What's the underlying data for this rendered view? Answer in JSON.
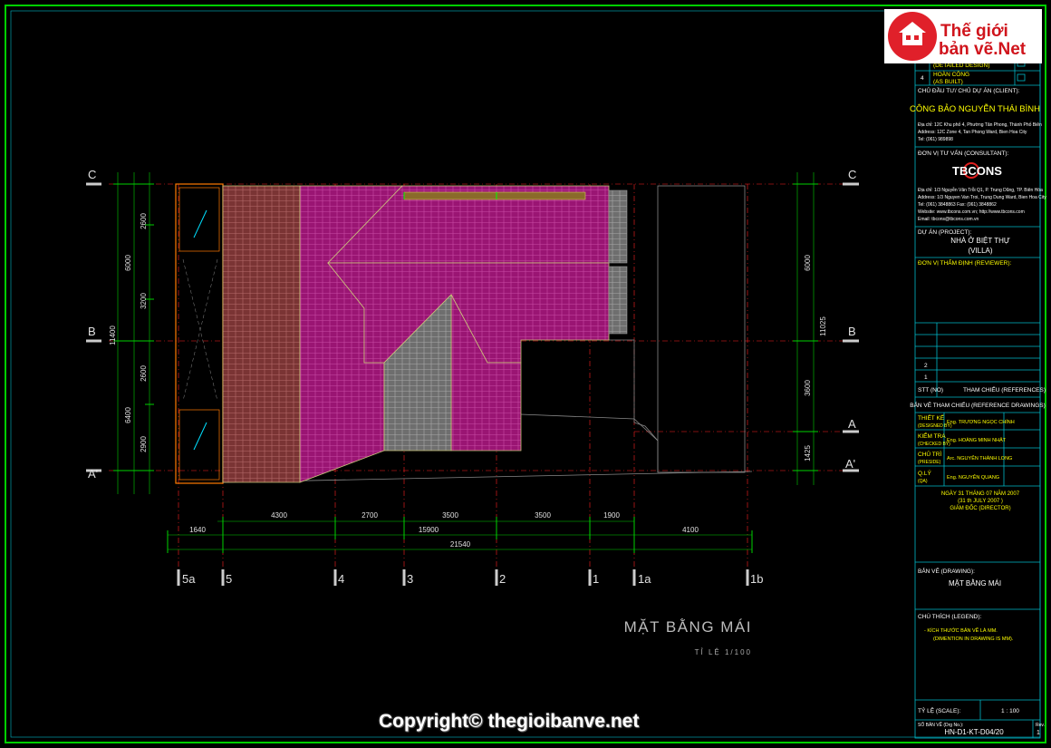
{
  "drawing": {
    "grid_rows": [
      "C",
      "B",
      "A",
      "A'"
    ],
    "grid_cols": [
      "5a",
      "5",
      "4",
      "3",
      "2",
      "1",
      "1a",
      "1b"
    ],
    "dims_top": [
      "4300",
      "2700",
      "3500",
      "3500",
      "1900"
    ],
    "dims_mid": [
      "1640",
      "15900",
      "4100"
    ],
    "dims_total": "21540",
    "dims_left_inner": [
      "2600",
      "3200",
      "2600",
      "2900"
    ],
    "dims_left_outer": [
      "6000",
      "6400"
    ],
    "dim_left_total": "11400",
    "dims_right": [
      "6000",
      "3600",
      "1425"
    ],
    "dim_right_total": "11025",
    "title": "MẶT BẰNG MÁI",
    "scale": "TỈ LỆ 1/100"
  },
  "title_block": {
    "rev_top_label": "(DETAILED DESIGN)",
    "rev_4_no": "4",
    "rev_4_label": "HOÀN CÔNG",
    "rev_4_sub": "(AS BUILT)",
    "client_label": "CHỦ ĐẦU TƯ/ CHỦ DỰ ÁN (CLIENT):",
    "client_name": "CÔNG BẢO NGUYỄN THÁI BÌNH",
    "client_addr1": "Địa chỉ: 12C Khu phố 4, Phường Tân Phong, Thành Phố Biên",
    "client_addr2": "Address: 12C Zone 4, Tan Phong Ward, Bien Hoa City",
    "client_tel": "Tel: (061) 989898",
    "consultant_label": "ĐƠN VỊ TƯ VẤN (CONSULTANT):",
    "consultant_logo": "TBCONS",
    "consultant_addr1": "Địa chỉ: 1/3 Nguyễn Văn Trỗi Q1, P. Trung Dũng, TP. Biên Hòa",
    "consultant_addr2": "Address: 1/3 Nguyen Van Troi, Trung Dung Ward, Bien Hoa City",
    "consultant_tel": "Tel: (061) 3848863          Fax: (061) 3848862",
    "consultant_web": "Website: www.tbcons.com.vn; http://www.tbcons.com",
    "consultant_email": "Email: tbcons@tbcons.com.vn",
    "project_label": "DỰ ÁN (PROJECT):",
    "project_name": "NHÀ Ở BIỆT THỰ",
    "project_sub": "(VILLA)",
    "reviewer_label": "ĐƠN VỊ THẨM ĐỊNH (REVIEWER):",
    "ref_no_2": "2",
    "ref_no_1": "1",
    "ref_stt": "STT (NO)",
    "ref_label": "THAM CHIẾU (REFERENCES)",
    "ref_drawings": "BẢN VẼ THAM CHIẾU (REFERENCE DRAWINGS)",
    "role_design": "THIẾT KẾ",
    "role_design_sub": "(DESIGNED BY)",
    "role_design_name": "Eng. TRƯƠNG NGỌC CHÍNH",
    "role_check": "KIỂM TRA",
    "role_check_sub": "(CHECKED BY)",
    "role_check_name": "Eng. HOÀNG MINH NHẬT",
    "role_chair": "CHỦ TRÌ",
    "role_chair_sub": "(PRESIDE)",
    "role_chair_name": "Arc. NGUYỄN THÀNH LONG",
    "role_mgr": "Q.LÝ",
    "role_mgr_sub": "(QA)",
    "role_mgr_name": "Eng. NGUYỄN QUANG",
    "date_line1": "NGÀY 31 THÁNG 07 NĂM 2007",
    "date_line2": "(31 th JULY 2007 )",
    "date_line3": "GIÁM ĐỐC (DIRECTOR)",
    "drawing_label": "BẢN VẼ (DRAWING):",
    "drawing_name": "MẶT BẰNG MÁI",
    "legend_label": "CHÚ THÍCH (LEGEND):",
    "legend_1": "- KÍCH THƯỚC BẢN VẼ LÀ MM.",
    "legend_2": "(DIMENTION IN DRAWING IS MM).",
    "scale_label": "TỶ LỆ (SCALE):",
    "scale_value": "1 : 100",
    "drawing_no_label": "SỐ BẢN VẼ (Drg No.):",
    "drawing_no": "HN-D1-KT-D04/20",
    "rev_label": "Rev.",
    "rev_value": "1"
  },
  "watermark": {
    "logo_line1": "Thế giới",
    "logo_line2": "bản vẽ.Net",
    "copyright": "Copyright© thegioibanve.net"
  },
  "colors": {
    "frame": "#00d000",
    "roof_magenta": "#9a1573",
    "roof_brown": "#7a3434",
    "roof_gray": "#6e6e6e",
    "cyan": "#00b8c8",
    "yellow": "#ffff00",
    "grid_red": "#ff2020"
  }
}
